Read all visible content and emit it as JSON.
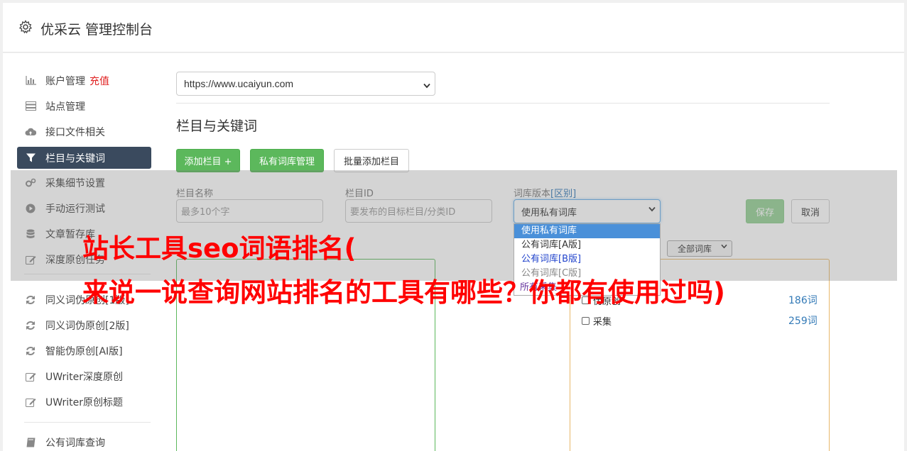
{
  "app": {
    "title": "优采云 管理控制台",
    "icon": "gear-icon"
  },
  "sidebar": {
    "items": [
      {
        "label": "账户管理",
        "extra": "充值",
        "icon": "bar-chart-icon"
      },
      {
        "label": "站点管理",
        "icon": "server-icon"
      },
      {
        "label": "接口文件相关",
        "icon": "cloud-upload-icon"
      },
      {
        "label": "栏目与关键词",
        "icon": "filter-icon",
        "active": true
      },
      {
        "label": "采集细节设置",
        "icon": "gears-icon"
      },
      {
        "label": "手动运行测试",
        "icon": "play-circle-icon"
      },
      {
        "label": "文章暂存库",
        "icon": "database-icon"
      },
      {
        "label": "深度原创任务",
        "icon": "edit-icon"
      },
      {
        "label": "同义词伪原创[1版]",
        "icon": "refresh-icon"
      },
      {
        "label": "同义词伪原创[2版]",
        "icon": "refresh-icon"
      },
      {
        "label": "智能伪原创[AI版]",
        "icon": "refresh-icon"
      },
      {
        "label": "UWriter深度原创",
        "icon": "edit-icon"
      },
      {
        "label": "UWriter原创标题",
        "icon": "edit-icon"
      },
      {
        "label": "公有词库查询",
        "icon": "book-icon"
      }
    ]
  },
  "site_select": {
    "value": "https://www.ucaiyun.com"
  },
  "section": {
    "title": "栏目与关键词"
  },
  "toolbar": {
    "add_column": "添加栏目 +",
    "private_lib": "私有词库管理",
    "batch_add": "批量添加栏目"
  },
  "form": {
    "column_name_label": "栏目名称",
    "column_name_placeholder": "最多10个字",
    "column_id_label": "栏目ID",
    "column_id_placeholder": "要发布的目标栏目/分类ID",
    "lib_version_label": "词库版本",
    "lib_version_link": "[区别]",
    "lib_version_value": "使用私有词库",
    "save": "保存",
    "cancel": "取消",
    "lib_filter": "全部词库"
  },
  "dropdown": {
    "options": [
      "使用私有词库",
      "公有词库[A版]",
      "公有词库[B版]",
      "公有词库[C版]"
    ],
    "partial": "所有采集"
  },
  "categories": [
    {
      "label": "伪原创",
      "count": "186词"
    },
    {
      "label": "采集",
      "count": "259词"
    }
  ],
  "watermark": {
    "line1": "站长工具seo词语排名(",
    "line2": "来说一说查询网站排名的工具有哪些？你都有使用过吗)"
  },
  "colors": {
    "accent": "#5cb85c",
    "sidebar_active": "#3a4a5e",
    "link": "#337ab7",
    "watermark": "#ff0000"
  }
}
